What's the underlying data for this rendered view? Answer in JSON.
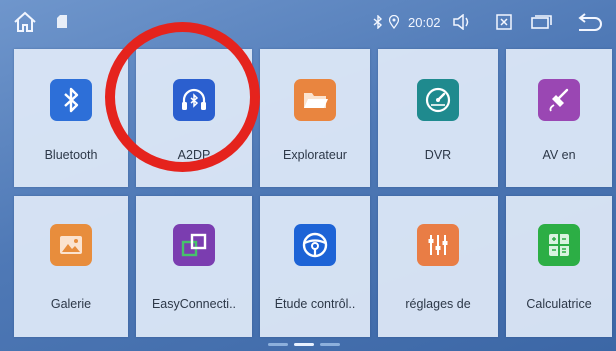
{
  "status_bar": {
    "icons": [
      "home-icon",
      "sd-card-icon",
      "bluetooth-status-icon",
      "location-icon",
      "volume-icon",
      "close-box-icon",
      "window-icon",
      "back-icon"
    ],
    "time": "20:02"
  },
  "apps": [
    {
      "label": "Bluetooth",
      "icon": "bluetooth-icon",
      "color": "#2d6fd8"
    },
    {
      "label": "A2DP",
      "icon": "headphones-bluetooth-icon",
      "color": "#2b5fcf"
    },
    {
      "label": "Explorateur",
      "icon": "folder-icon",
      "color": "#e9853f"
    },
    {
      "label": "DVR",
      "icon": "speedometer-icon",
      "color": "#1f8a8e"
    },
    {
      "label": "AV en",
      "icon": "av-cable-icon",
      "color": "#9a47b3"
    },
    {
      "label": "Galerie",
      "icon": "picture-icon",
      "color": "#e88d3c"
    },
    {
      "label": "EasyConnecti..",
      "icon": "screen-link-icon",
      "color": "#7b3db0"
    },
    {
      "label": "Étude contrôl..",
      "icon": "steering-wheel-icon",
      "color": "#1d63d6"
    },
    {
      "label": "réglages de",
      "icon": "equalizer-icon",
      "color": "#e97d45"
    },
    {
      "label": "Calculatrice",
      "icon": "calculator-icon",
      "color": "#2cae45"
    }
  ],
  "annotation": {
    "shape": "circle",
    "color": "#e5231d",
    "target": "A2DP"
  },
  "pager": {
    "pages": 3,
    "active": 2
  }
}
